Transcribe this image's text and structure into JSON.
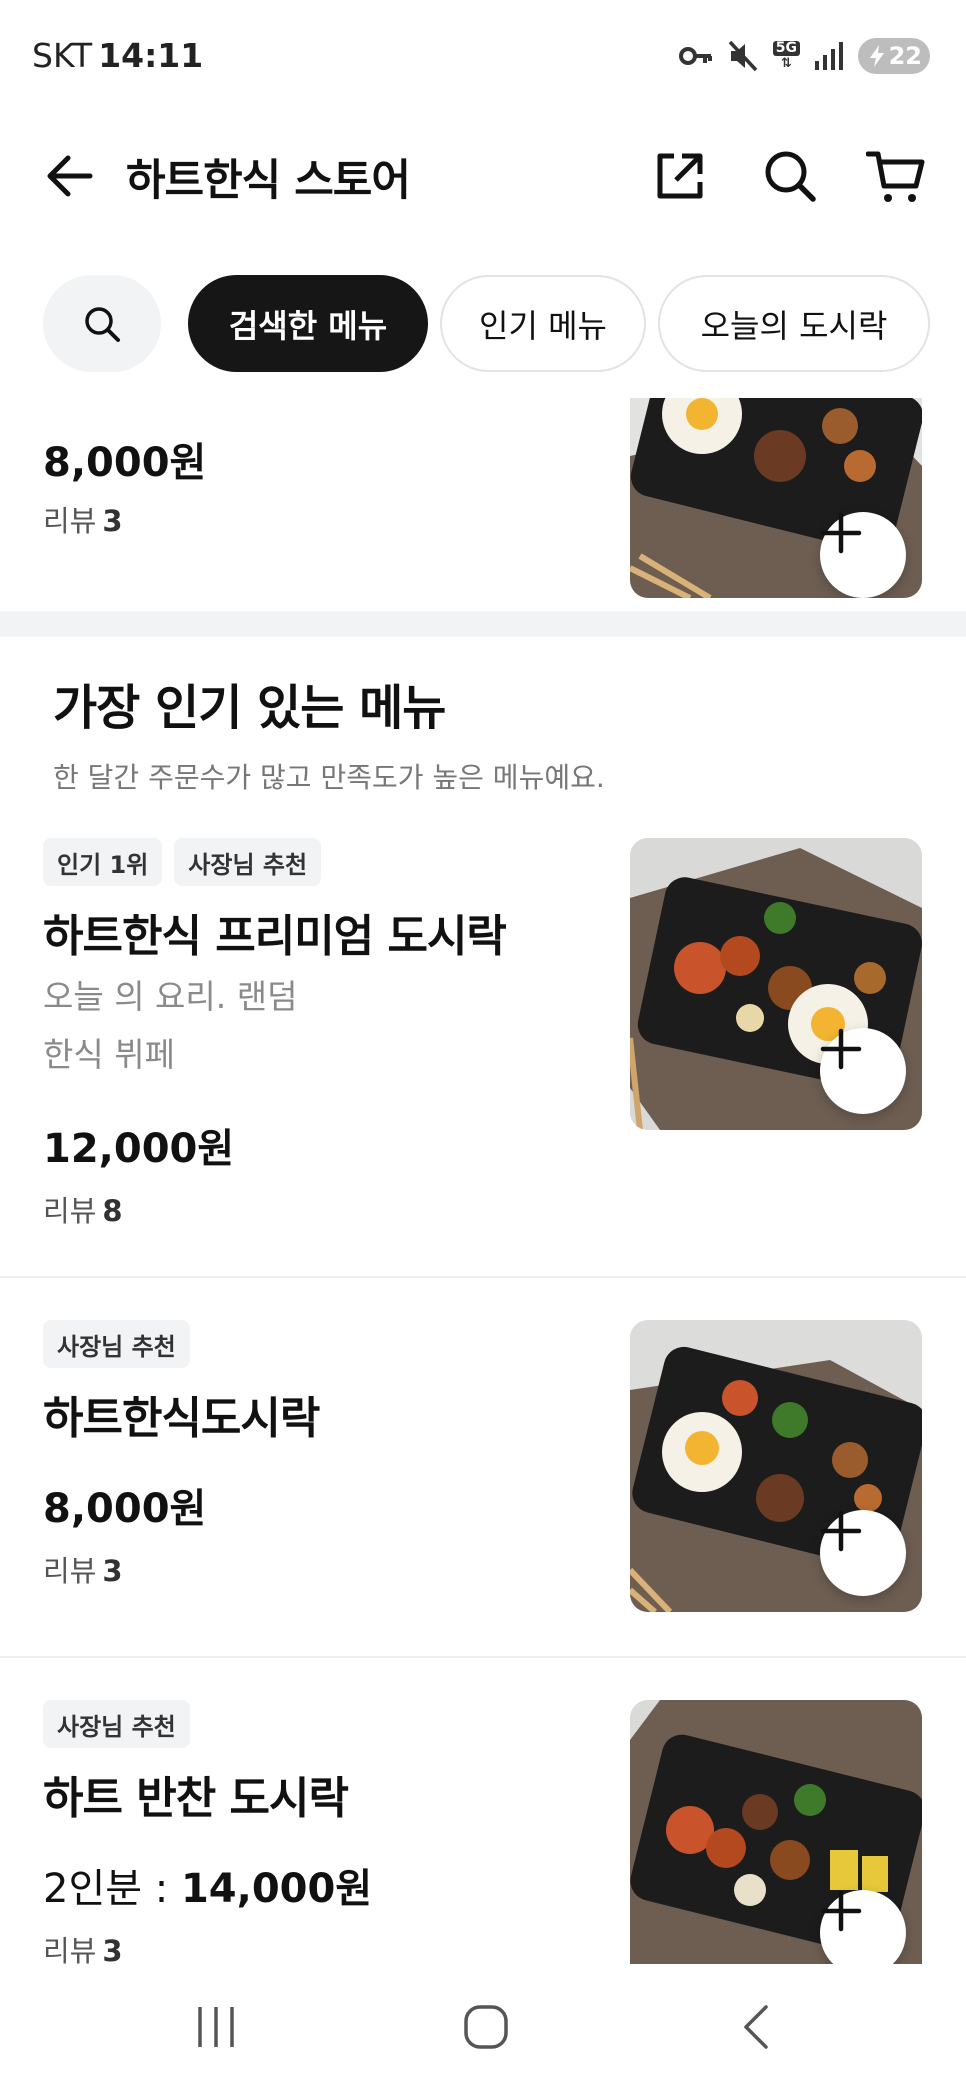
{
  "status_bar": {
    "carrier": "SKT",
    "time": "14:11",
    "network": "5G",
    "battery": "22"
  },
  "header": {
    "title": "하트한식 스토어"
  },
  "filters": {
    "chips": [
      "검색한 메뉴",
      "인기 메뉴",
      "오늘의 도시락"
    ]
  },
  "top_item": {
    "price": "8,000원",
    "reviews_label": "리뷰",
    "reviews_count": "3"
  },
  "popular_section": {
    "title": "가장 인기 있는 메뉴",
    "subtitle": "한 달간 주문수가 많고 만족도가 높은 메뉴예요."
  },
  "items": [
    {
      "badges": [
        "인기 1위",
        "사장님 추천"
      ],
      "name": "하트한식 프리미엄 도시락",
      "desc": [
        "오늘 의 요리. 랜덤",
        "한식 뷔페"
      ],
      "price": "12,000원",
      "reviews_label": "리뷰",
      "reviews_count": "8"
    },
    {
      "badges": [
        "사장님 추천"
      ],
      "name": "하트한식도시락",
      "price": "8,000원",
      "reviews_label": "리뷰",
      "reviews_count": "3"
    },
    {
      "badges": [
        "사장님 추천"
      ],
      "name": "하트 반찬 도시락",
      "price_prefix": "2인분 : ",
      "price": "14,000원",
      "reviews_label": "리뷰",
      "reviews_count": "3"
    }
  ],
  "colors": {
    "chip_active_bg": "#161616",
    "badge_bg": "#f2f3f5",
    "section_gap": "#f2f3f5"
  }
}
